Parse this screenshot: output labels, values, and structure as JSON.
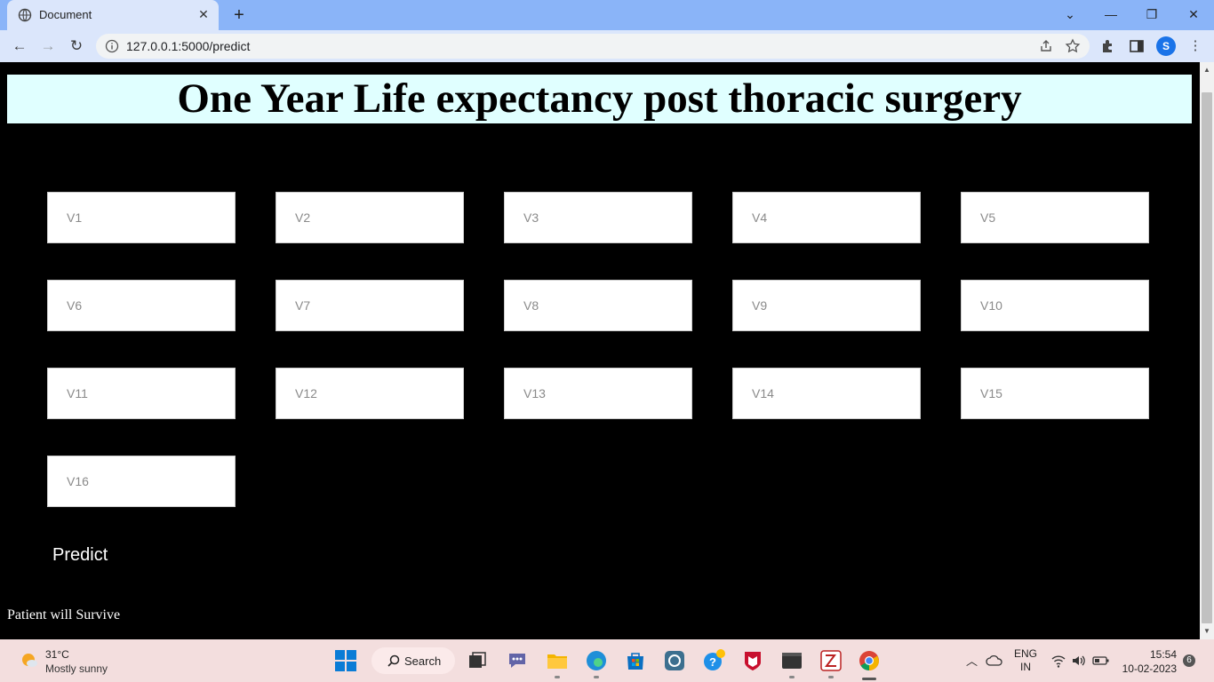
{
  "browser": {
    "tab_title": "Document",
    "url": "127.0.0.1:5000/predict",
    "profile_initial": "S"
  },
  "page": {
    "title": "One Year Life expectancy post thoracic surgery",
    "fields": [
      {
        "placeholder": "V1"
      },
      {
        "placeholder": "V2"
      },
      {
        "placeholder": "V3"
      },
      {
        "placeholder": "V4"
      },
      {
        "placeholder": "V5"
      },
      {
        "placeholder": "V6"
      },
      {
        "placeholder": "V7"
      },
      {
        "placeholder": "V8"
      },
      {
        "placeholder": "V9"
      },
      {
        "placeholder": "V10"
      },
      {
        "placeholder": "V11"
      },
      {
        "placeholder": "V12"
      },
      {
        "placeholder": "V13"
      },
      {
        "placeholder": "V14"
      },
      {
        "placeholder": "V15"
      },
      {
        "placeholder": "V16"
      }
    ],
    "predict_label": "Predict",
    "result_text": "Patient will Survive"
  },
  "taskbar": {
    "weather_temp": "31°C",
    "weather_desc": "Mostly sunny",
    "search_label": "Search",
    "lang_line1": "ENG",
    "lang_line2": "IN",
    "time": "15:54",
    "date": "10-02-2023",
    "notification_count": "6"
  },
  "colors": {
    "header_bg": "#e0ffff",
    "page_bg": "#000000",
    "tabbar_bg": "#8ab4f8",
    "toolbar_bg": "#dbe6fb",
    "taskbar_bg": "#f3dede"
  }
}
